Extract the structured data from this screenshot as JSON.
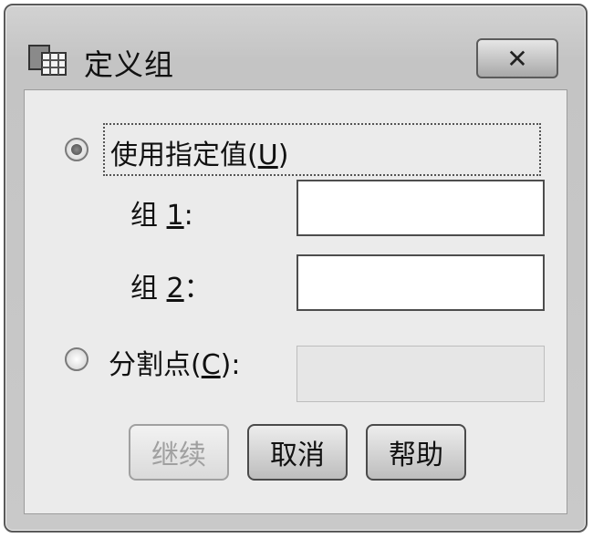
{
  "window": {
    "title": "定义组",
    "close_symbol": "✕"
  },
  "options": {
    "specified": {
      "label": "使用指定值",
      "mnemonic": "U",
      "selected": true
    },
    "cutpoint": {
      "label": "分割点",
      "mnemonic": "C",
      "selected": false
    }
  },
  "group1": {
    "prefix": "组 ",
    "mnemonic": "1",
    "suffix": ":",
    "value": ""
  },
  "group2": {
    "prefix": "组 ",
    "mnemonic": "2",
    "suffix": "：",
    "value": ""
  },
  "cutpoint_value": "",
  "buttons": {
    "continue": "继续",
    "cancel": "取消",
    "help": "帮助"
  },
  "icons": {
    "app": "dialog-table-icon",
    "close": "close-icon"
  }
}
